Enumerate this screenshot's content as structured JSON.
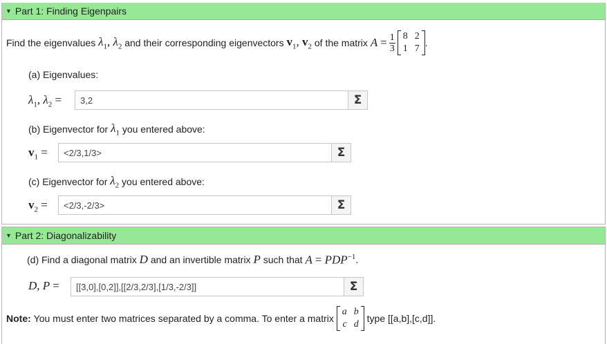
{
  "part1": {
    "title": "Part 1: Finding Eigenpairs",
    "prompt_before": "Find the eigenvalues",
    "prompt_mid1": "and their corresponding eigenvectors",
    "prompt_mid2": "of the matrix",
    "matrix_A": {
      "frac_num": "1",
      "frac_den": "3",
      "cells": [
        "8",
        "2",
        "1",
        "7"
      ]
    },
    "a": {
      "label": "(a) Eigenvalues:",
      "value": "3,2"
    },
    "b": {
      "label_before": "(b) Eigenvector for",
      "label_after": "you entered above:",
      "value": "<2/3,1/3>"
    },
    "c": {
      "label_before": "(c) Eigenvector for",
      "label_after": "you entered above:",
      "value": "<2/3,-2/3>"
    }
  },
  "part2": {
    "title": "Part 2: Diagonalizability",
    "d": {
      "label_before": "(d) Find a diagonal matrix",
      "label_mid": "and an invertible matrix",
      "label_after": "such that",
      "value": "[[3,0],[0,2]],[[2/3,2/3],[1/3,-2/3]]"
    },
    "note_bold": "Note:",
    "note_text": "You must enter two matrices separated by a comma. To enter a matrix",
    "note_matrix": [
      "a",
      "b",
      "c",
      "d"
    ],
    "note_after": "type [[a,b],[c,d]]."
  },
  "icons": {
    "toggle": "triangle-down-icon",
    "equation_editor": "sigma-icon"
  },
  "colors": {
    "header_bg": "#96e796"
  }
}
